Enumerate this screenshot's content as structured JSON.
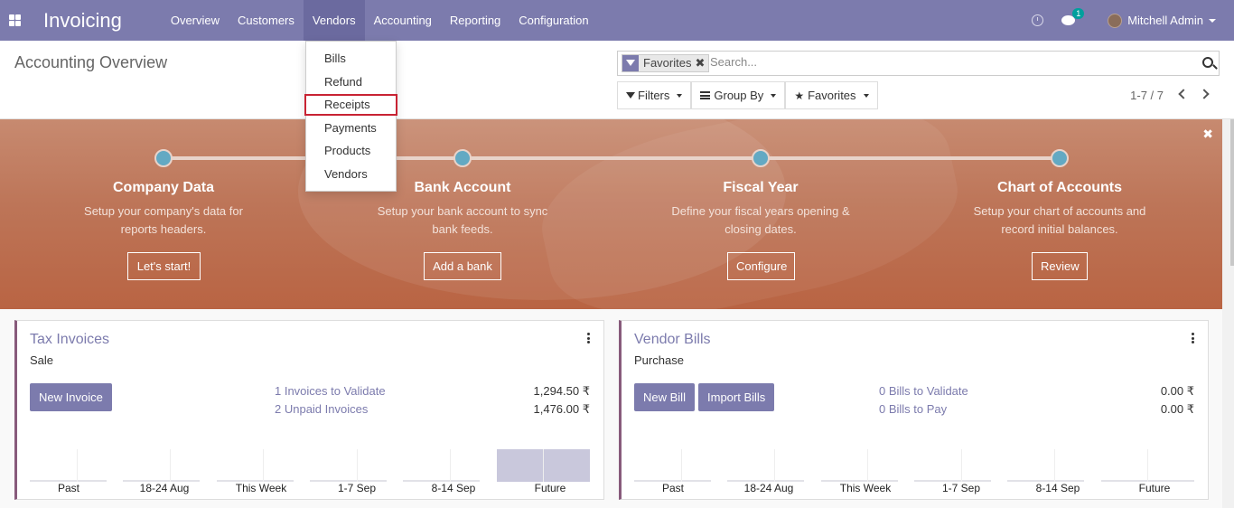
{
  "navbar": {
    "brand": "Invoicing",
    "menu": [
      "Overview",
      "Customers",
      "Vendors",
      "Accounting",
      "Reporting",
      "Configuration"
    ],
    "active_menu": "Vendors",
    "chat_count": "1",
    "user_name": "Mitchell Admin"
  },
  "vendors_menu": {
    "items": [
      "Bills",
      "Refund",
      "Receipts",
      "Payments",
      "Products",
      "Vendors"
    ],
    "highlighted": "Receipts"
  },
  "control_panel": {
    "title": "Accounting Overview",
    "facet_label": "Favorites",
    "facet_remove": "✖",
    "search_placeholder": "Search...",
    "filters_label": "Filters",
    "groupby_label": "Group By",
    "favorites_label": "Favorites",
    "pager": "1-7 / 7"
  },
  "onboarding": {
    "close": "✖",
    "steps": [
      {
        "title": "Company Data",
        "desc_line1": "Setup your company's data for",
        "desc_line2": "reports headers.",
        "button": "Let's start!"
      },
      {
        "title": "Bank Account",
        "desc_line1": "Setup your bank account to sync",
        "desc_line2": "bank feeds.",
        "button": "Add a bank"
      },
      {
        "title": "Fiscal Year",
        "desc_line1": "Define your fiscal years opening &",
        "desc_line2": "closing dates.",
        "button": "Configure"
      },
      {
        "title": "Chart of Accounts",
        "desc_line1": "Setup your chart of accounts and",
        "desc_line2": "record initial balances.",
        "button": "Review"
      }
    ]
  },
  "cards": [
    {
      "title": "Tax Invoices",
      "subtitle": "Sale",
      "buttons": [
        "New Invoice"
      ],
      "stats": [
        {
          "label": "1 Invoices to Validate",
          "amount": "1,294.50 ₹"
        },
        {
          "label": "2 Unpaid Invoices",
          "amount": "1,476.00 ₹"
        }
      ],
      "graph_labels": [
        "Past",
        "18-24 Aug",
        "This Week",
        "1-7 Sep",
        "8-14 Sep",
        "Future"
      ],
      "graph_values": [
        0,
        0,
        0,
        0,
        0,
        1476.0
      ]
    },
    {
      "title": "Vendor Bills",
      "subtitle": "Purchase",
      "buttons": [
        "New Bill",
        "Import Bills"
      ],
      "stats": [
        {
          "label": "0 Bills to Validate",
          "amount": "0.00 ₹"
        },
        {
          "label": "0 Bills to Pay",
          "amount": "0.00 ₹"
        }
      ],
      "graph_labels": [
        "Past",
        "18-24 Aug",
        "This Week",
        "1-7 Sep",
        "8-14 Sep",
        "Future"
      ],
      "graph_values": [
        0,
        0,
        0,
        0,
        0,
        0
      ]
    }
  ],
  "colors": {
    "navbar": "#7c7bad",
    "accent": "#7c7bad",
    "card_border": "#875a7b",
    "highlight_outline": "#c82333",
    "step_dot": "#63a9c3"
  }
}
